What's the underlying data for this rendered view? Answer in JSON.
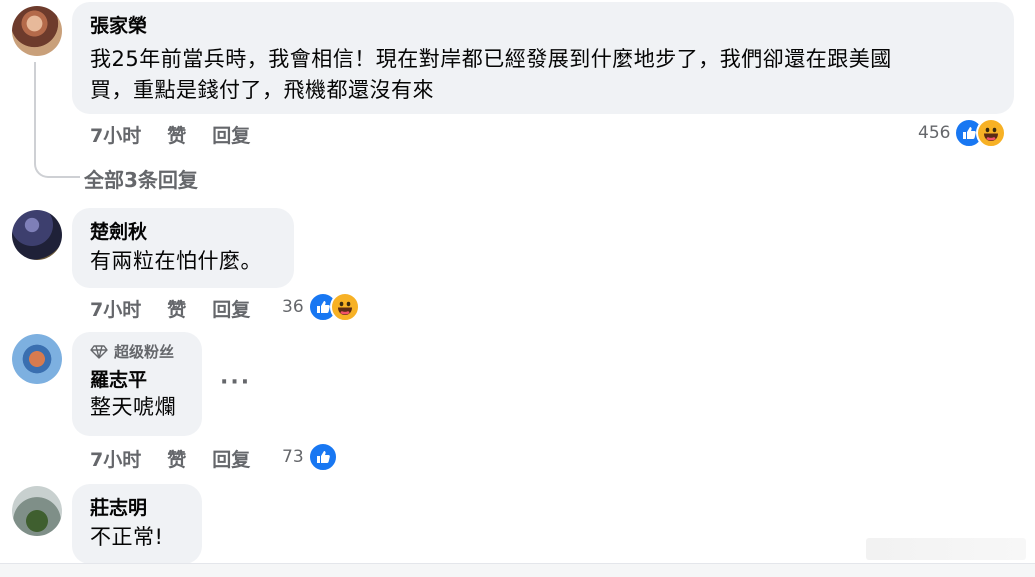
{
  "comments": [
    {
      "name": "張家榮",
      "text_line1": "我25年前當兵時，我會相信！現在對岸都已經發展到什麼地步了，我們卻還在跟美國",
      "text_line2": "買，重點是錢付了，飛機都還沒有來",
      "time": "7小时",
      "like": "赞",
      "reply": "回复",
      "reaction_count": "456",
      "reactions": [
        "like",
        "haha"
      ]
    },
    {
      "name": "楚劍秋",
      "text": "有兩粒在怕什麼。",
      "time": "7小时",
      "like": "赞",
      "reply": "回复",
      "reaction_count": "36",
      "reactions": [
        "like",
        "haha"
      ]
    },
    {
      "badge": "超级粉丝",
      "name": "羅志平",
      "text": "整天唬爛",
      "time": "7小时",
      "like": "赞",
      "reply": "回复",
      "reaction_count": "73",
      "reactions": [
        "like"
      ]
    },
    {
      "name": "莊志明",
      "text": "不正常!"
    }
  ],
  "replies_link": "全部3条回复",
  "more_menu": "···",
  "colors": {
    "bubble": "#f0f2f5",
    "meta": "#65676b",
    "like": "#1877f2",
    "haha": "#f7b125"
  }
}
